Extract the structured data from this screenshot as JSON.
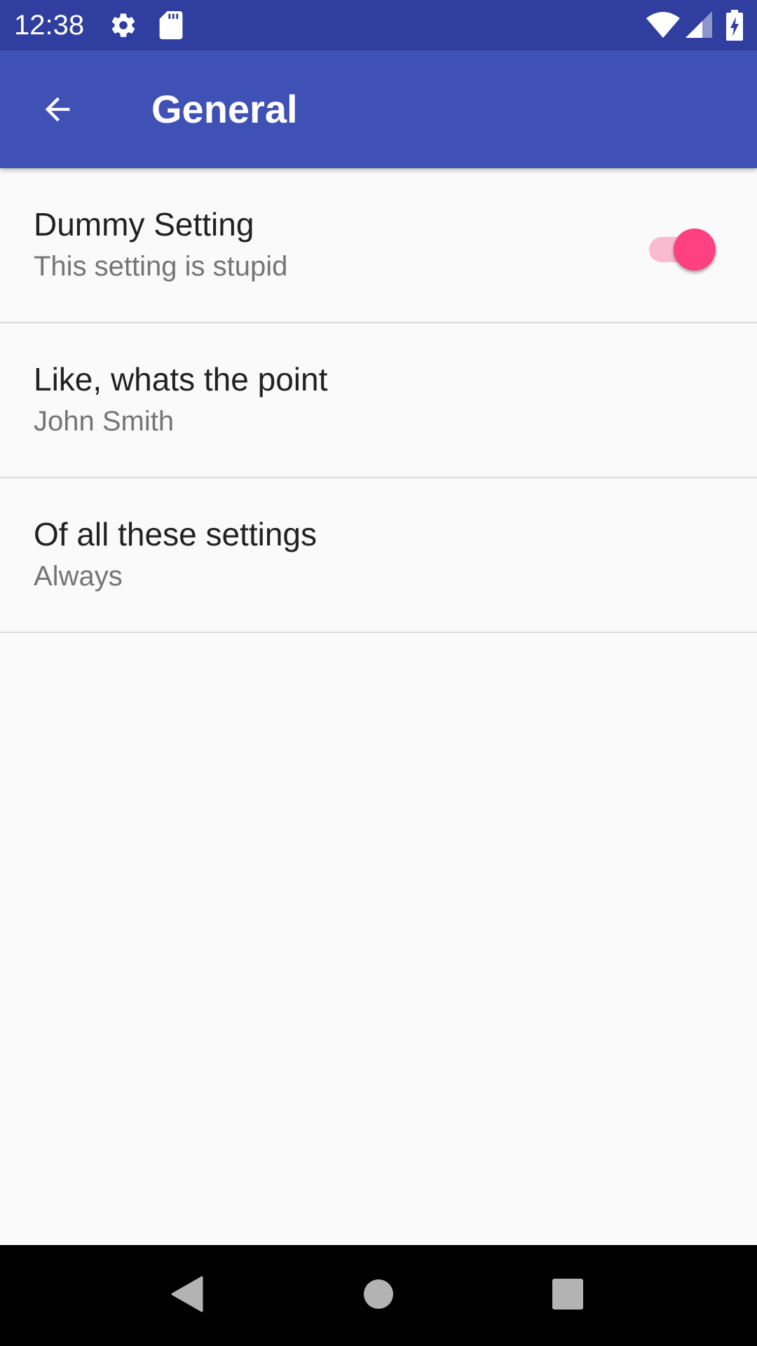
{
  "status_bar": {
    "time": "12:38",
    "icons": [
      "settings-gear-icon",
      "sd-card-icon",
      "wifi-icon",
      "cell-signal-icon",
      "battery-charging-icon"
    ]
  },
  "app_bar": {
    "title": "General",
    "back_icon": "arrow-back-icon"
  },
  "preferences": [
    {
      "title": "Dummy Setting",
      "summary": "This setting is stupid",
      "type": "switch",
      "checked": true
    },
    {
      "title": "Like, whats the point",
      "summary": "John Smith",
      "type": "text"
    },
    {
      "title": "Of all these settings",
      "summary": "Always",
      "type": "list"
    }
  ],
  "nav_bar": {
    "buttons": [
      "back-triangle-icon",
      "home-circle-icon",
      "recents-square-icon"
    ]
  },
  "colors": {
    "status_bar": "#303f9f",
    "app_bar": "#3f51b5",
    "accent": "#ff4081",
    "switch_track": "#f8bbd0",
    "background": "#fafafa"
  }
}
